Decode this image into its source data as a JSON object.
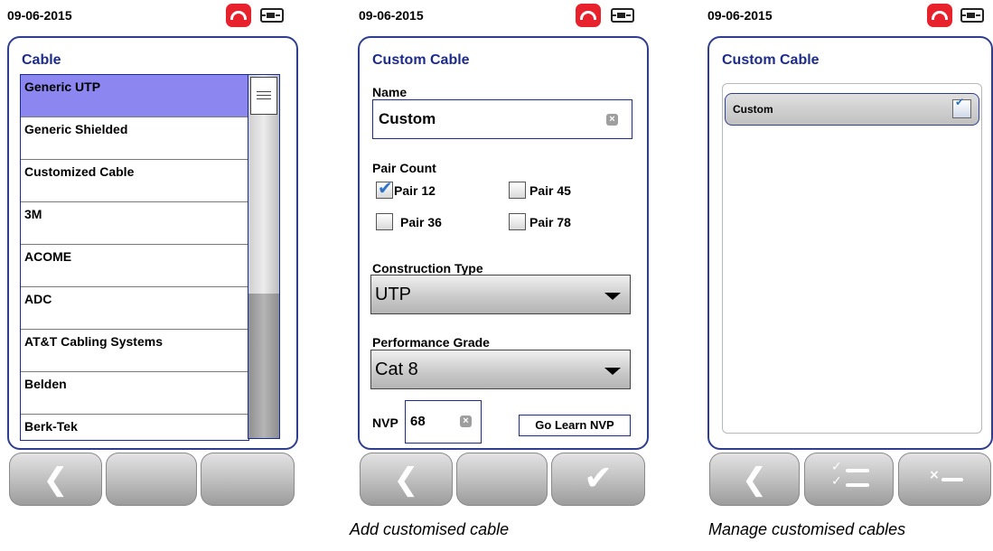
{
  "status": {
    "date": "09-06-2015"
  },
  "screen1": {
    "title": "Cable",
    "items": [
      "Generic UTP",
      "Generic Shielded",
      "Customized Cable",
      "3M",
      "ACOME",
      "ADC",
      "AT&T Cabling Systems",
      "Belden",
      "Berk-Tek"
    ],
    "selected_index": 0,
    "softkeys": [
      "back-icon",
      "",
      ""
    ]
  },
  "screen2": {
    "title": "Custom Cable",
    "name_label": "Name",
    "name_value": "Custom",
    "pair_count_label": "Pair Count",
    "pairs": [
      {
        "label": "Pair 12",
        "checked": true
      },
      {
        "label": "Pair 45",
        "checked": false
      },
      {
        "label": "Pair 36",
        "checked": false
      },
      {
        "label": "Pair 78",
        "checked": false
      }
    ],
    "construction_label": "Construction Type",
    "construction_value": "UTP",
    "performance_label": "Performance Grade",
    "performance_value": "Cat 8",
    "nvp_label": "NVP",
    "nvp_value": "68",
    "learn_button": "Go Learn NVP",
    "caption": "Add customised cable"
  },
  "screen3": {
    "title": "Custom Cable",
    "items": [
      {
        "label": "Custom",
        "checked": true
      }
    ],
    "caption": "Manage customised cables"
  },
  "colors": {
    "title_blue": "#1c2c8c",
    "frame_blue": "#2f3e8f",
    "selected": "#8b86f0",
    "hangup_red": "#e8222d",
    "check_blue": "#2c73c9"
  }
}
